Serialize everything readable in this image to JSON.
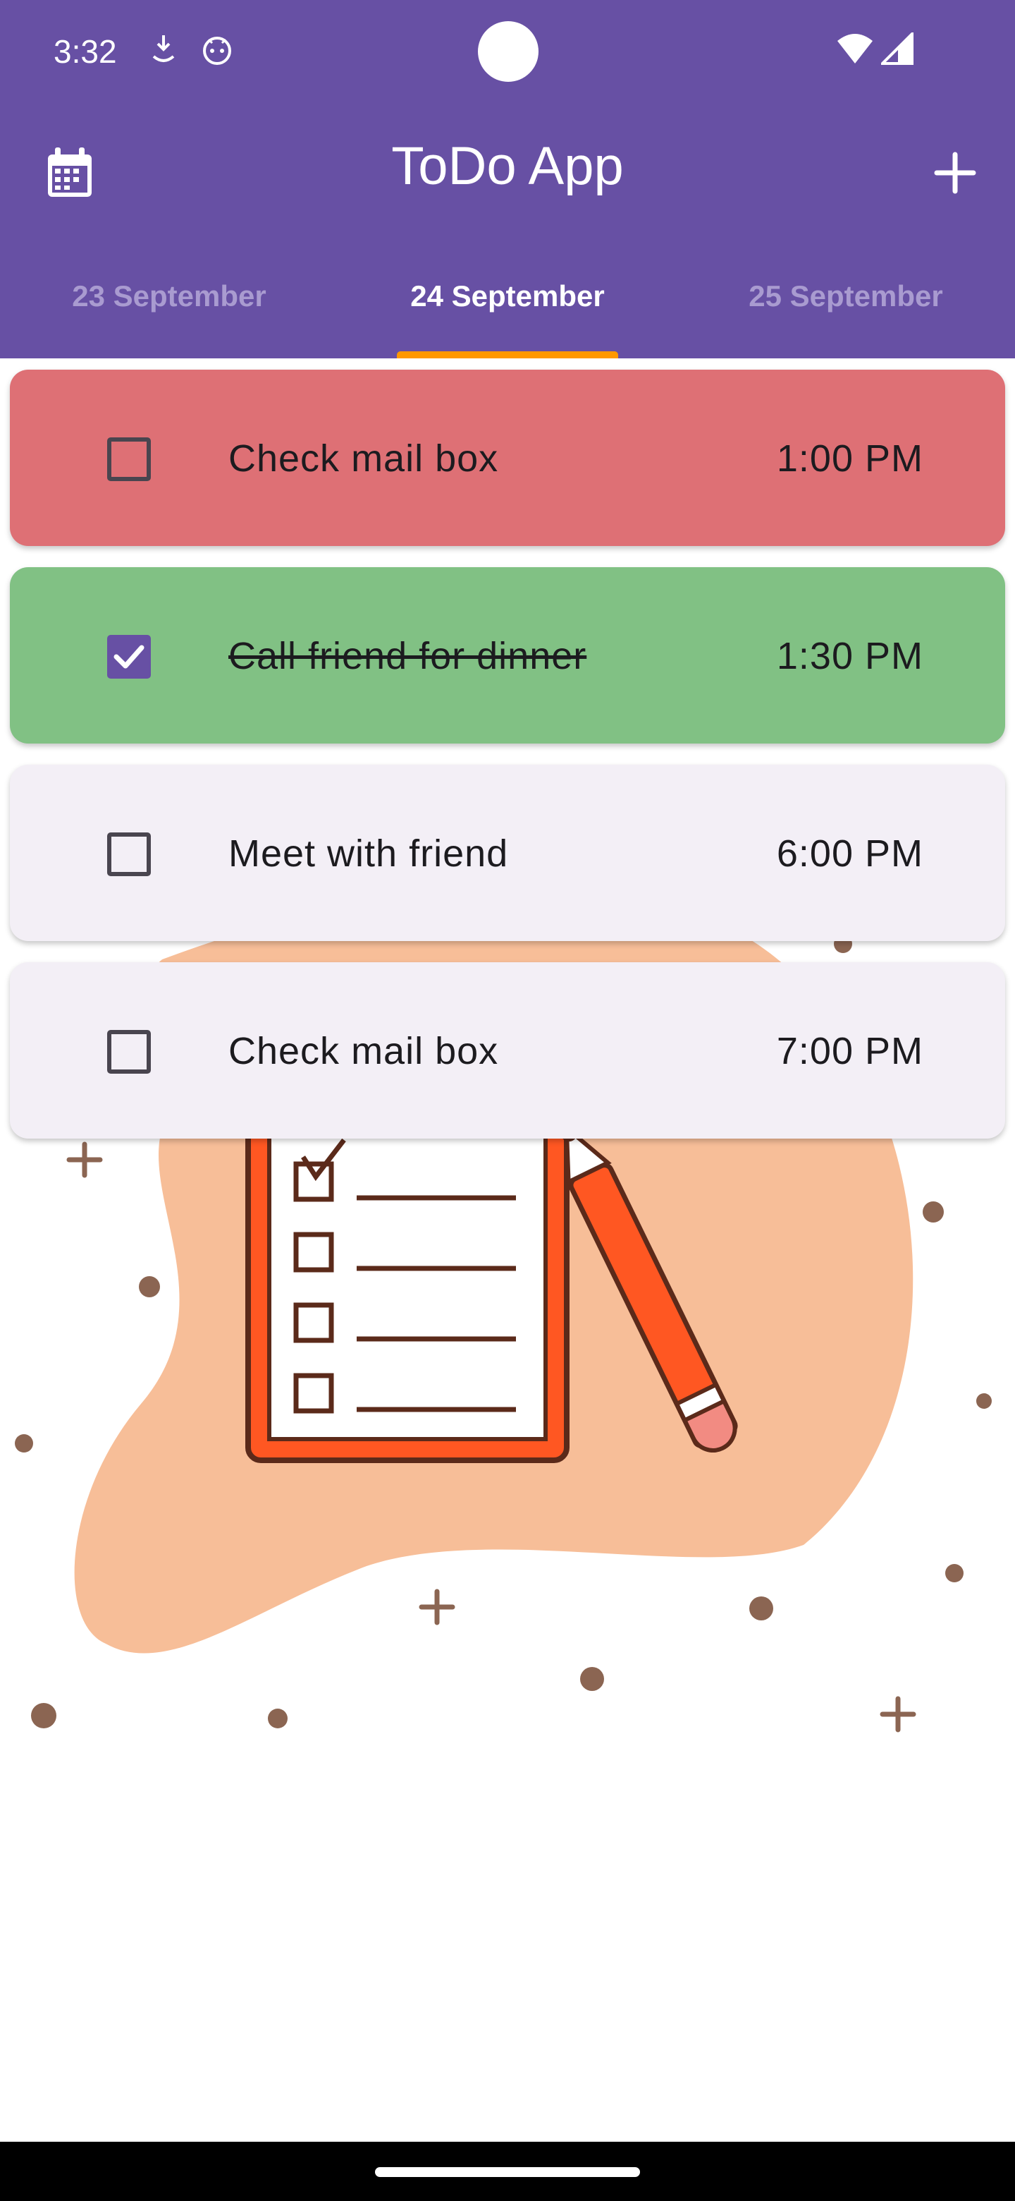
{
  "status_bar": {
    "time": "3:32",
    "icons": [
      "download-status-icon",
      "android-robot-icon",
      "wifi-icon",
      "cell-signal-icon"
    ]
  },
  "app_bar": {
    "title": "ToDo App",
    "left_icon": "calendar-icon",
    "right_icon": "plus-icon",
    "background": "#6750A4"
  },
  "tabs": {
    "items": [
      "23 September",
      "24 September",
      "25 September"
    ],
    "selected": "24 September",
    "indicator_color": "#FF9800"
  },
  "tasks": [
    {
      "title": "Check mail box",
      "time": "1:00 PM",
      "checked": false,
      "color": "#DE7075"
    },
    {
      "title": "Call friend for dinner",
      "time": "1:30 PM",
      "checked": true,
      "color": "#81C184"
    },
    {
      "title": "Meet with friend",
      "time": "6:00 PM",
      "checked": false,
      "color": "#F3EFF6"
    },
    {
      "title": "Check mail box",
      "time": "7:00 PM",
      "checked": false,
      "color": "#F3EFF6"
    }
  ],
  "illustration": "todo-checklist-illustration"
}
